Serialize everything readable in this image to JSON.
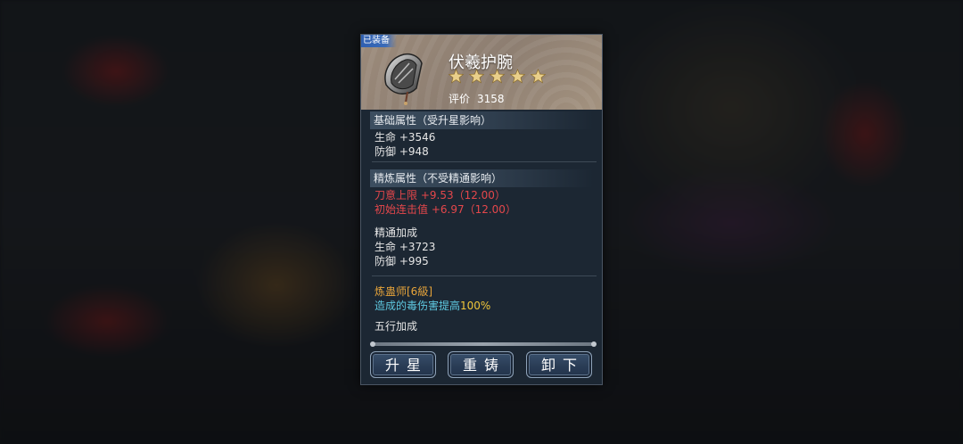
{
  "panel": {
    "equipped_tag": "已装备",
    "item": {
      "name": "伏羲护腕",
      "stars": 5,
      "rating_label": "评价",
      "rating_value": "3158",
      "icon": "bracer-icon"
    },
    "base_attrs": {
      "title": "基础属性（受升星影响）",
      "lines": [
        "生命 +3546",
        "防御 +948"
      ]
    },
    "refine_attrs": {
      "title": "精炼属性（不受精通影响）",
      "lines": [
        "刀意上限 +9.53（12.00）",
        "初始连击值 +6.97（12.00）"
      ]
    },
    "mastery": {
      "title": "精通加成",
      "lines": [
        "生命 +3723",
        "防御 +995"
      ]
    },
    "set_bonus": {
      "title": "炼蛊师[6級]",
      "desc_text": "造成的毒伤害提高",
      "desc_value": "100%"
    },
    "five_elements": "五行加成",
    "buttons": {
      "upgrade_star": "升星",
      "reforge": "重铸",
      "unequip": "卸下"
    },
    "colors": {
      "refine_red": "#e5474b",
      "set_orange": "#e7a43a",
      "desc_cyan": "#5ec8e0",
      "value_yellow": "#f0c63a"
    }
  }
}
